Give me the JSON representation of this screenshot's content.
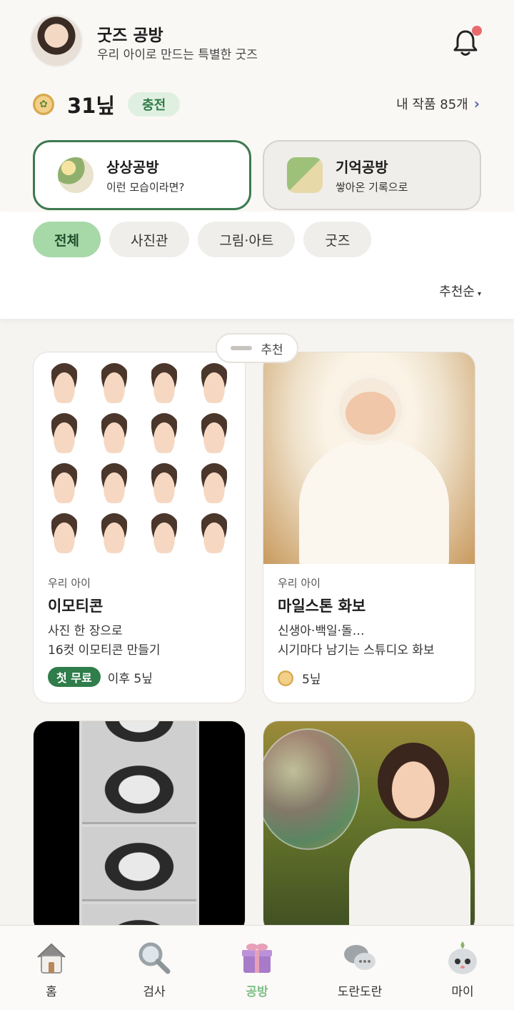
{
  "header": {
    "title": "굿즈 공방",
    "subtitle": "우리 아이로 만드는 특별한 굿즈"
  },
  "wallet": {
    "amount": "31닢",
    "charge_label": "충전",
    "my_works_label": "내 작품 85개",
    "chevron": "›"
  },
  "workshops": [
    {
      "title": "상상공방",
      "subtitle": "이런 모습이라면?"
    },
    {
      "title": "기억공방",
      "subtitle": "쌓아온 기록으로"
    }
  ],
  "filters": [
    "전체",
    "사진관",
    "그림·아트",
    "굿즈"
  ],
  "sort": {
    "label": "추천순",
    "caret": "▾"
  },
  "recommend_tag": "추천",
  "cards": [
    {
      "kicker": "우리 아이",
      "title": "이모티콘",
      "desc1": "사진 한 장으로",
      "desc2": "16컷 이모티콘 만들기",
      "badge": "첫 무료",
      "price": "이후 5닢"
    },
    {
      "kicker": "우리 아이",
      "title": "마일스톤 화보",
      "desc1": "신생아·백일·돌…",
      "desc2": "시기마다 남기는 스튜디오 화보",
      "price": "5닢"
    }
  ],
  "nav": [
    {
      "label": "홈",
      "icon": "house-icon"
    },
    {
      "label": "검사",
      "icon": "magnifier-icon"
    },
    {
      "label": "공방",
      "icon": "gift-icon"
    },
    {
      "label": "도란도란",
      "icon": "chat-bubbles-icon"
    },
    {
      "label": "마이",
      "icon": "character-face-icon"
    }
  ],
  "colors": {
    "accent_green": "#2f7d4a",
    "active_chip": "#a7d8a8",
    "active_nav_label": "#7fbf87",
    "notification_dot": "#e86a6a"
  }
}
